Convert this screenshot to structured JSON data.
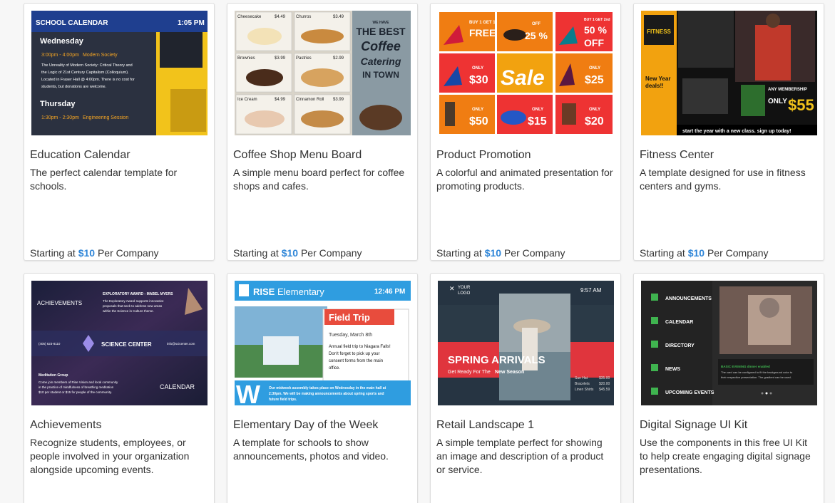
{
  "templates": [
    {
      "title": "Education Calendar",
      "description": "The perfect calendar template for schools.",
      "price_prefix": "Starting at",
      "price": "$10",
      "price_suffix": "Per Company",
      "thumb": {
        "header": "SCHOOL CALENDAR",
        "time": "1:05 PM",
        "day1": "Wednesday",
        "day1_time": "3:00pm - 4:00pm",
        "day1_event": "Modern Society",
        "day1_text": "The Unreality of Modern Society: Critical Theory and the Logic of 21st Century Capitalism (Colloquium). Located in Fraser Hall @ 4:00pm. There is no cost for students, but donations are welcome.",
        "day2": "Thursday",
        "day2_time": "1:30pm - 2:30pm",
        "day2_event": "Engineering Session"
      }
    },
    {
      "title": "Coffee Shop Menu Board",
      "description": "A simple menu board perfect for coffee shops and cafes.",
      "price_prefix": "Starting at",
      "price": "$10",
      "price_suffix": "Per Company",
      "thumb": {
        "items": [
          {
            "name": "Cheesecake",
            "price": "$4.49"
          },
          {
            "name": "Churros",
            "price": "$3.49"
          },
          {
            "name": "Brownies",
            "price": "$3.99"
          },
          {
            "name": "Pastries",
            "price": "$2.99"
          },
          {
            "name": "Ice Cream",
            "price": "$4.99"
          },
          {
            "name": "Cinnamon Roll",
            "price": "$3.99"
          }
        ],
        "tagline_small": "WE HAVE",
        "tagline1": "THE BEST",
        "tagline2": "Coffee",
        "tagline3": "Catering",
        "tagline4": "IN TOWN"
      }
    },
    {
      "title": "Product Promotion",
      "description": "A colorful and animated presentation for promoting products.",
      "price_prefix": "Starting at",
      "price": "$10",
      "price_suffix": "Per Company",
      "thumb": {
        "sale": "Sale",
        "offers": [
          "BUY 1 GET 1 FREE",
          "OFF 25%",
          "BUY 1 GET 2nd 50% OFF",
          "ONLY $30",
          "ONLY $25",
          "ONLY $50",
          "ONLY $15",
          "ONLY $20"
        ]
      }
    },
    {
      "title": "Fitness Center",
      "description": "A template designed for use in fitness centers and gyms.",
      "price_prefix": "Starting at",
      "price": "$10",
      "price_suffix": "Per Company",
      "thumb": {
        "logo": "FITNESS",
        "headline": "New Year deals!!",
        "membership": "ANY MEMBERSHIP",
        "only": "ONLY",
        "price": "$55",
        "footer": "start the year with a new class. sign up today!"
      }
    },
    {
      "title": "Achievements",
      "description": "Recognize students, employees, or people involved in your organization alongside upcoming events.",
      "price_prefix": "",
      "price": "",
      "price_suffix": "",
      "thumb": {
        "left_label": "ACHIEVEMENTS",
        "award": "EXPLORATORY AWARD - MABEL MYERS",
        "center": "SCIENCE CENTER",
        "phone": "(405) 623-8110",
        "email": "info@scicenter.com",
        "group": "Meditation Group",
        "calendar": "CALENDAR"
      }
    },
    {
      "title": "Elementary Day of the Week",
      "description": "A template for schools to show announcements, photos and video.",
      "price_prefix": "",
      "price": "",
      "price_suffix": "",
      "thumb": {
        "brand_bold": "RISE",
        "brand_light": "Elementary",
        "time": "12:46 PM",
        "event": "Field Trip",
        "date": "Tuesday, March 8th",
        "text": "Annual field trip to Niagara Falls! Don't forget to pick up your consent forms from the main office.",
        "ticker": "Our midweek assembly takes place on Wednesday in the main hall at 2:30pm. We will be making announcements about spring sports and future field trips."
      }
    },
    {
      "title": "Retail Landscape 1",
      "description": "A simple template perfect for showing an image and description of a product or service.",
      "price_prefix": "",
      "price": "",
      "price_suffix": "",
      "thumb": {
        "logo1": "YOUR",
        "logo2": "LOGO",
        "time": "9:57 AM",
        "headline": "SPRING ARRIVALS",
        "sub1": "Get Ready For The",
        "sub2": "New Season",
        "prices": [
          {
            "name": "Sun Hat",
            "price": "$35.00"
          },
          {
            "name": "Bracelets",
            "price": "$20.00"
          },
          {
            "name": "Linen Shirts",
            "price": "$45.59"
          }
        ]
      }
    },
    {
      "title": "Digital Signage UI Kit",
      "description": "Use the components in this free UI Kit to help create engaging digital signage presentations.",
      "price_prefix": "",
      "price": "",
      "price_suffix": "",
      "thumb": {
        "menu": [
          "ANNOUNCEMENTS",
          "CALENDAR",
          "DIRECTORY",
          "NEWS",
          "UPCOMING EVENTS"
        ]
      }
    }
  ]
}
